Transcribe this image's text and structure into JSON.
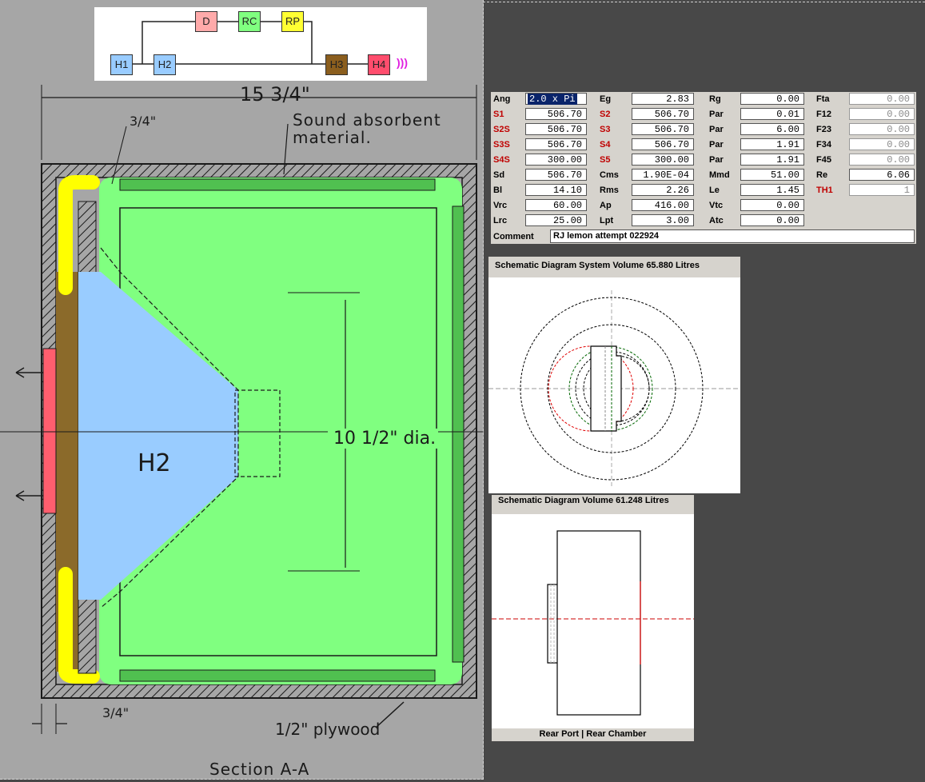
{
  "drawing": {
    "network": {
      "blocks": [
        {
          "id": "D",
          "color": "#ffaaaa"
        },
        {
          "id": "RC",
          "color": "#80ff80"
        },
        {
          "id": "RP",
          "color": "#ffff33"
        },
        {
          "id": "H1",
          "color": "#99ccff"
        },
        {
          "id": "H2",
          "color": "#99ccff"
        },
        {
          "id": "H3",
          "color": "#8b5e1e"
        },
        {
          "id": "H4",
          "color": "#ff4d6d"
        }
      ],
      "output_symbol": ")))"
    },
    "width_dim": "15 3/4\"",
    "wall_dim_top": "3/4\"",
    "sound_absorbent": "Sound absorbent",
    "material": "material.",
    "h2_label": "H2",
    "driver_dia": "10 1/2\" dia.",
    "wall_dim_bottom": "3/4\"",
    "plywood": "1/2\" plywood",
    "section": "Section A-A"
  },
  "params": {
    "col1": [
      {
        "label": "Ang",
        "value": "2.0 x Pi",
        "red": false,
        "selected": true
      },
      {
        "label": "S1",
        "value": "506.70",
        "red": true
      },
      {
        "label": "S2S",
        "value": "506.70",
        "red": true
      },
      {
        "label": "S3S",
        "value": "506.70",
        "red": true
      },
      {
        "label": "S4S",
        "value": "300.00",
        "red": true
      },
      {
        "label": "Sd",
        "value": "506.70",
        "red": false
      },
      {
        "label": "Bl",
        "value": "14.10",
        "red": false
      },
      {
        "label": "Vrc",
        "value": "60.00",
        "red": false
      },
      {
        "label": "Lrc",
        "value": "25.00",
        "red": false
      }
    ],
    "col2": [
      {
        "label": "Eg",
        "value": "2.83",
        "red": false
      },
      {
        "label": "S2",
        "value": "506.70",
        "red": true
      },
      {
        "label": "S3",
        "value": "506.70",
        "red": true
      },
      {
        "label": "S4",
        "value": "506.70",
        "red": true
      },
      {
        "label": "S5",
        "value": "300.00",
        "red": true
      },
      {
        "label": "Cms",
        "value": "1.90E-04",
        "red": false
      },
      {
        "label": "Rms",
        "value": "2.26",
        "red": false
      },
      {
        "label": "Ap",
        "value": "416.00",
        "red": false
      },
      {
        "label": "Lpt",
        "value": "3.00",
        "red": false
      }
    ],
    "col3": [
      {
        "label": "Rg",
        "value": "0.00",
        "red": false
      },
      {
        "label": "Par",
        "value": "0.01",
        "red": false
      },
      {
        "label": "Par",
        "value": "6.00",
        "red": false
      },
      {
        "label": "Par",
        "value": "1.91",
        "red": false
      },
      {
        "label": "Par",
        "value": "1.91",
        "red": false
      },
      {
        "label": "Mmd",
        "value": "51.00",
        "red": false
      },
      {
        "label": "Le",
        "value": "1.45",
        "red": false
      },
      {
        "label": "Vtc",
        "value": "0.00",
        "red": false
      },
      {
        "label": "Atc",
        "value": "0.00",
        "red": false
      }
    ],
    "col4": [
      {
        "label": "Fta",
        "value": "0.00",
        "red": false,
        "disabled": true
      },
      {
        "label": "F12",
        "value": "0.00",
        "red": false,
        "disabled": true
      },
      {
        "label": "F23",
        "value": "0.00",
        "red": false,
        "disabled": true
      },
      {
        "label": "F34",
        "value": "0.00",
        "red": false,
        "disabled": true
      },
      {
        "label": "F45",
        "value": "0.00",
        "red": false,
        "disabled": true
      },
      {
        "label": "Re",
        "value": "6.06",
        "red": false,
        "disabled": false
      },
      {
        "label": "TH1",
        "value": "1",
        "red": true,
        "disabled": true
      }
    ],
    "comment_label": "Comment",
    "comment_value": "RJ lemon attempt 022924"
  },
  "schematic_system": {
    "title": "Schematic Diagram    System Volume 65.880 Litres"
  },
  "schematic_volume": {
    "title": "Schematic Diagram    Volume 61.248 Litres",
    "footer": "Rear Port  |  Rear Chamber"
  },
  "colors": {
    "green": "#80ff80",
    "blue": "#99ccff",
    "yellow": "#ffff00",
    "brown": "#8b6a2a",
    "red": "#ff5e6e"
  }
}
